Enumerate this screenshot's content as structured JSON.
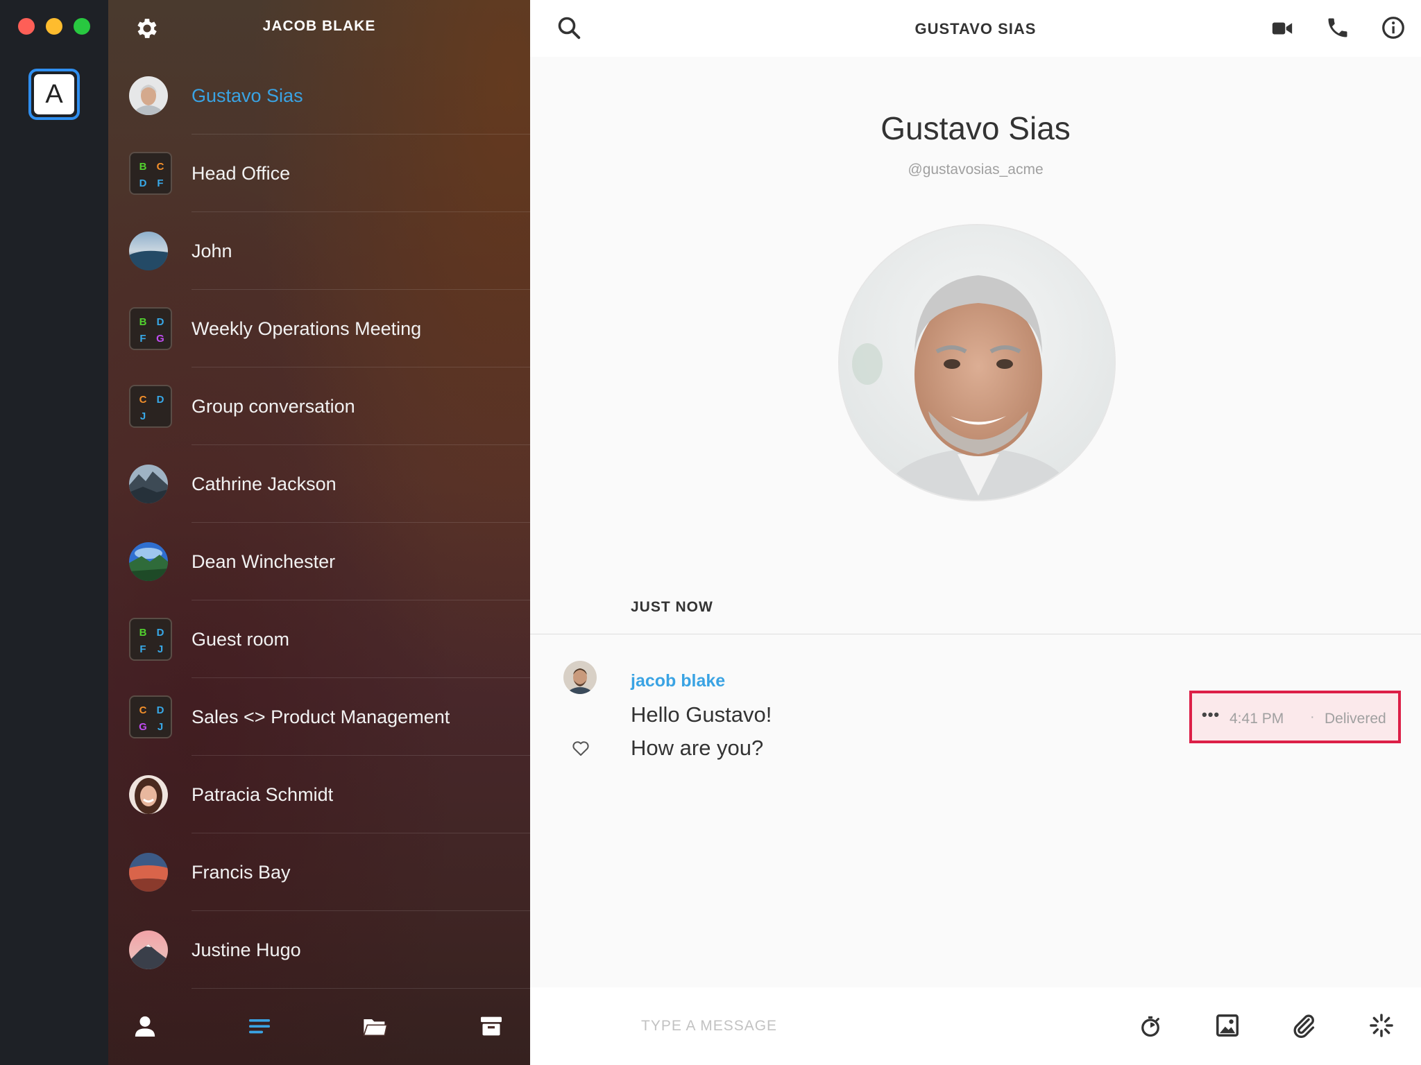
{
  "window": {
    "buttons": [
      "close",
      "minimize",
      "zoom"
    ]
  },
  "rail": {
    "team_badge": "A"
  },
  "sidebar": {
    "title": "JACOB BLAKE",
    "settings_icon": "gear-icon",
    "conversations": [
      {
        "label": "Gustavo Sias",
        "kind": "person",
        "active": true
      },
      {
        "label": "Head Office",
        "kind": "group",
        "initials": [
          "B",
          "C",
          "D",
          "F"
        ]
      },
      {
        "label": "John",
        "kind": "person"
      },
      {
        "label": "Weekly Operations Meeting",
        "kind": "group",
        "initials": [
          "B",
          "D",
          "F",
          "G"
        ]
      },
      {
        "label": "Group conversation",
        "kind": "group",
        "initials": [
          "C",
          "D",
          "J",
          ""
        ]
      },
      {
        "label": "Cathrine Jackson",
        "kind": "person"
      },
      {
        "label": "Dean Winchester",
        "kind": "person"
      },
      {
        "label": "Guest room",
        "kind": "group",
        "initials": [
          "B",
          "D",
          "F",
          "J"
        ]
      },
      {
        "label": "Sales <> Product Management",
        "kind": "group",
        "initials": [
          "C",
          "D",
          "G",
          "J"
        ]
      },
      {
        "label": "Patracia Schmidt",
        "kind": "person"
      },
      {
        "label": "Francis Bay",
        "kind": "person"
      },
      {
        "label": "Justine Hugo",
        "kind": "person"
      }
    ],
    "footer_icons": [
      "contacts-icon",
      "conversations-icon",
      "files-icon",
      "archive-icon"
    ]
  },
  "colors": {
    "accent": "#3aa3e3",
    "highlight_border": "#dc1f47",
    "initial_green": "#52d12f",
    "initial_orange": "#f5902b",
    "initial_blue": "#38a9e8",
    "initial_purple": "#c14cf2"
  },
  "main": {
    "header_title": "GUSTAVO SIAS",
    "header_icons": [
      "search-icon",
      "video-call-icon",
      "phone-call-icon",
      "info-icon"
    ],
    "profile": {
      "name": "Gustavo Sias",
      "handle": "@gustavosias_acme"
    },
    "divider_label": "JUST NOW",
    "message": {
      "author": "jacob blake",
      "line1": "Hello Gustavo!",
      "line2": "How are you?",
      "menu": "•••",
      "time": "4:41 PM",
      "separator": "·",
      "status": "Delivered"
    },
    "composer": {
      "placeholder": "TYPE A MESSAGE",
      "icons": [
        "timer-icon",
        "image-icon",
        "attachment-icon",
        "ping-icon"
      ]
    }
  }
}
